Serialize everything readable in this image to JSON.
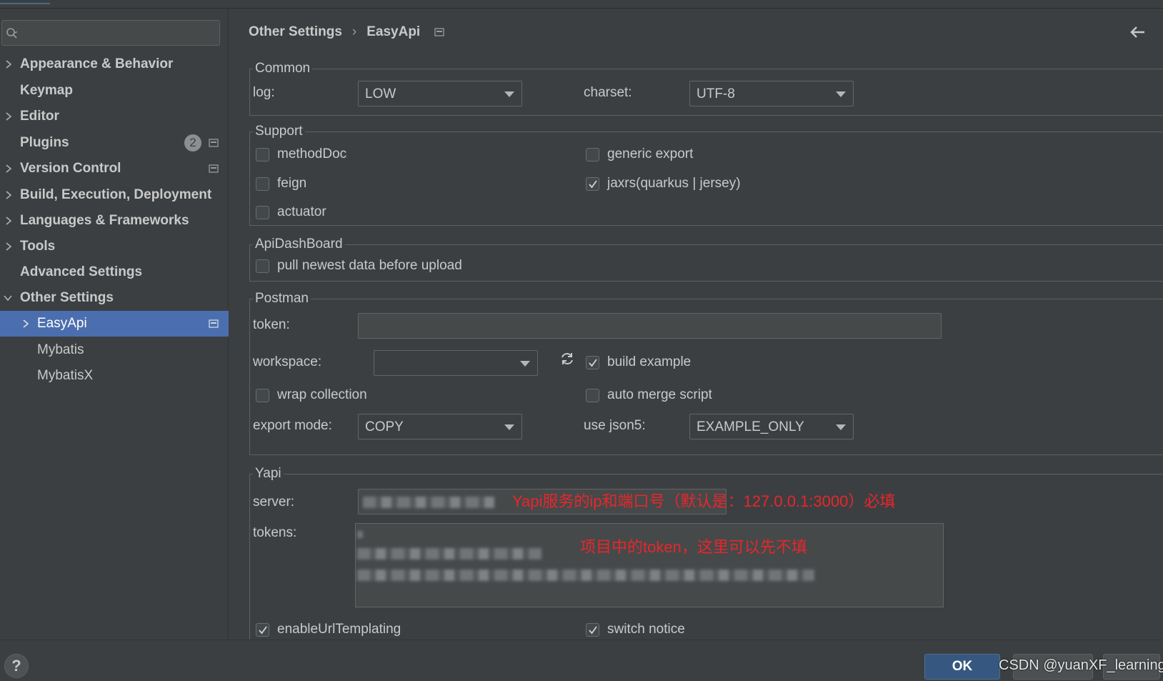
{
  "sidebar": {
    "search_placeholder": "",
    "items": [
      {
        "label": "Appearance & Behavior",
        "expandable": true,
        "bold": true
      },
      {
        "label": "Keymap",
        "expandable": false,
        "bold": true
      },
      {
        "label": "Editor",
        "expandable": true,
        "bold": true
      },
      {
        "label": "Plugins",
        "expandable": false,
        "bold": true,
        "badge": "2"
      },
      {
        "label": "Version Control",
        "expandable": true,
        "bold": true
      },
      {
        "label": "Build, Execution, Deployment",
        "expandable": true,
        "bold": true
      },
      {
        "label": "Languages & Frameworks",
        "expandable": true,
        "bold": true
      },
      {
        "label": "Tools",
        "expandable": true,
        "bold": true
      },
      {
        "label": "Advanced Settings",
        "expandable": false,
        "bold": true
      },
      {
        "label": "Other Settings",
        "expandable": true,
        "expanded": true,
        "bold": true
      },
      {
        "label": "EasyApi",
        "expandable": true,
        "selected": true
      },
      {
        "label": "Mybatis"
      },
      {
        "label": "MybatisX"
      }
    ]
  },
  "header": {
    "breadcrumb_parent": "Other Settings",
    "breadcrumb_sep": "›",
    "breadcrumb_current": "EasyApi"
  },
  "common": {
    "legend": "Common",
    "log_label": "log:",
    "log_value": "LOW",
    "charset_label": "charset:",
    "charset_value": "UTF-8"
  },
  "support": {
    "legend": "Support",
    "method_doc": "methodDoc",
    "generic_export": "generic export",
    "feign": "feign",
    "jaxrs": "jaxrs(quarkus | jersey)",
    "actuator": "actuator"
  },
  "dashboard": {
    "legend": "ApiDashBoard",
    "pull_newest": "pull newest data before upload"
  },
  "postman": {
    "legend": "Postman",
    "token_label": "token:",
    "workspace_label": "workspace:",
    "build_example": "build example",
    "wrap_collection": "wrap collection",
    "auto_merge": "auto merge script",
    "export_mode_label": "export mode:",
    "export_mode_value": "COPY",
    "json5_label": "use json5:",
    "json5_value": "EXAMPLE_ONLY"
  },
  "yapi": {
    "legend": "Yapi",
    "server_label": "server:",
    "tokens_label": "tokens:",
    "server_annotation": "Yapi服务的ip和端口号（默认是：127.0.0.1:3000）必填",
    "tokens_annotation": "项目中的token，这里可以先不填",
    "enable_url_templating": "enableUrlTemplating",
    "switch_notice": "switch notice"
  },
  "footer": {
    "help": "?",
    "ok": "OK",
    "watermark": "CSDN @yuanXF_learning"
  },
  "colors": {
    "background": "#3c3f41",
    "selection": "#4b6eaf",
    "ok_button": "#365880",
    "annotation": "#e8262b"
  },
  "icons": {
    "search": "search-icon",
    "chevron_right": "chevron-right-icon",
    "chevron_down": "chevron-down-icon",
    "project": "project-level-icon",
    "back": "back-arrow-icon",
    "refresh": "refresh-icon",
    "check": "checkmark-icon"
  }
}
